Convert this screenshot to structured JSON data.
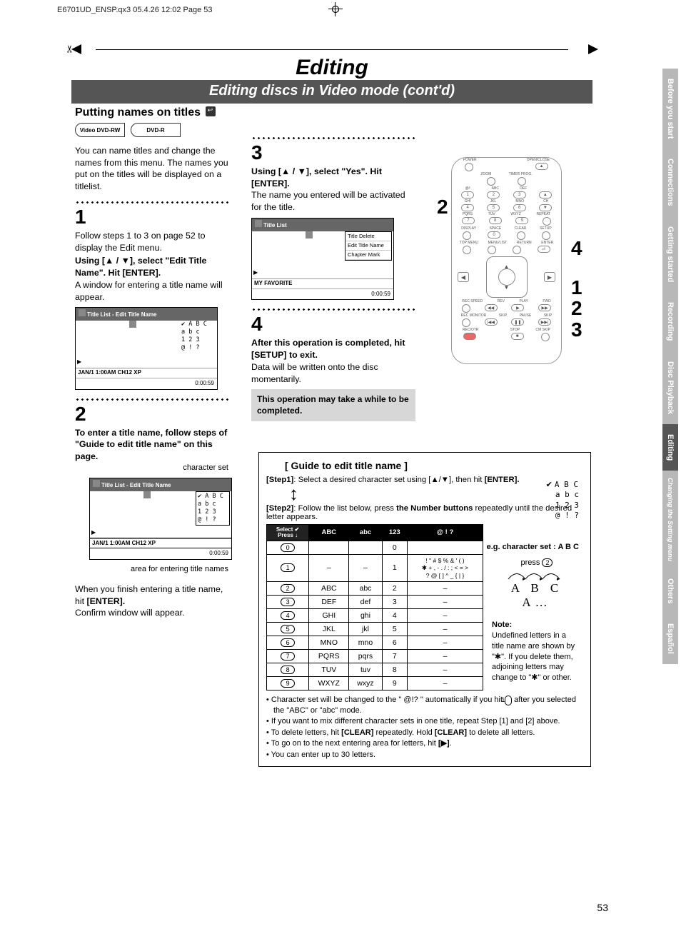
{
  "print_header": "E6701UD_ENSP.qx3  05.4.26 12:02  Page 53",
  "banner_title": "Editing",
  "banner_sub": "Editing discs in Video mode (cont'd)",
  "section_heading": "Putting names on titles",
  "disc_badges": [
    "Video DVD-RW",
    "DVD-R"
  ],
  "intro": "You can name titles and change the names from this menu. The names you put on the titles will be displayed on a titlelist.",
  "step1": {
    "num": "1",
    "p1": "Follow steps 1 to 3 on page 52 to display the Edit menu.",
    "b1": "Using [▲ / ▼], select \"Edit Title Name\". Hit [ENTER].",
    "p2": "A window for entering a title name will appear."
  },
  "tv1": {
    "header": "Title List - Edit Title Name",
    "charset": [
      "✔ A  B  C",
      "   a  b  c",
      "   1  2  3",
      "   @  !  ?"
    ],
    "status": "JAN/1 1:00AM CH12 XP",
    "foot": "0:00:59"
  },
  "step2": {
    "num": "2",
    "b1": "To enter a title name, follow steps of \"Guide to edit title name\" on this page.",
    "label_charset": "character set",
    "label_area": "area for entering title names",
    "p1": "When you finish entering a title name, hit ",
    "p1b": "[ENTER].",
    "p2": "Confirm window will appear."
  },
  "step3": {
    "num": "3",
    "b1": "Using [▲ / ▼], select \"Yes\". Hit [ENTER].",
    "p1": "The name you entered will be activated for the title."
  },
  "tv3": {
    "header": "Title List",
    "menu": [
      "Title Delete",
      "Edit Title Name",
      "Chapter Mark"
    ],
    "status": "MY FAVORITE",
    "foot": "0:00:59"
  },
  "step4": {
    "num": "4",
    "b1": "After this operation is completed, hit [SETUP] to exit.",
    "p1": "Data will be written onto the disc momentarily."
  },
  "note_box": "This operation may take a while to be completed.",
  "remote": {
    "top": [
      "POWER",
      "",
      "",
      "OPEN/CLOSE"
    ],
    "r1l": [
      "",
      "ZOOM",
      "TIMER PROG.",
      ""
    ],
    "keypad_labels": [
      [
        "@/:",
        "ABC",
        "DEF",
        ""
      ],
      [
        "GHI",
        "JKL",
        "MNO",
        "CH"
      ],
      [
        "PQRS",
        "TUV",
        "WXYZ",
        "REPEAT"
      ]
    ],
    "keypad": [
      [
        "1",
        "2",
        "3",
        "▲"
      ],
      [
        "4",
        "5",
        "6",
        "▼"
      ],
      [
        "7",
        "8",
        "9",
        ""
      ]
    ],
    "row4l": [
      "DISPLAY",
      "SPACE",
      "CLEAR",
      "SETUP"
    ],
    "row4": [
      "",
      "0",
      "",
      ""
    ],
    "row5l": [
      "TOP MENU",
      "MENU/LIST",
      "RETURN",
      "ENTER"
    ],
    "ctrl1l": [
      "REC SPEED",
      "REV",
      "PLAY",
      "FWD"
    ],
    "ctrl1": [
      "",
      "◀◀",
      "▶",
      "▶▶"
    ],
    "ctrl2l": [
      "REC MONITOR",
      "SKIP",
      "PAUSE",
      "SKIP"
    ],
    "ctrl2": [
      "",
      "|◀◀",
      "❚❚",
      "▶▶|"
    ],
    "ctrl3l": [
      "REC/OTR",
      "",
      "STOP",
      "CM SKIP"
    ],
    "ctrl3": [
      "",
      "",
      "■",
      ""
    ]
  },
  "callout_2": "2",
  "callout_4": "4",
  "callout_123": "1\n2\n3",
  "guide": {
    "title": "[ Guide to edit title name ]",
    "step1_l": "[Step1]",
    "step1_t": ": Select a desired character set using [▲/▼], then hit ",
    "step1_b": "[ENTER].",
    "mini_charset": [
      "A B C",
      "a b c",
      "1 2 3",
      "@ ! ?"
    ],
    "step2_l": "[Step2]",
    "step2_t": ": Follow the list below, press ",
    "step2_b": "the Number buttons",
    "step2_t2": " repeatedly until the desired letter appears.",
    "eg": "e.g. character set : A B C",
    "press": "press",
    "press_key": "2",
    "letters": "A  B  C  A…",
    "table_head_sel": "Select ✔\nPress",
    "table_head": [
      "ABC",
      "abc",
      "123",
      "@ ! ?"
    ],
    "rows": [
      {
        "k": "0",
        "c": [
          "<space>",
          "<space>",
          "0",
          "<space>"
        ]
      },
      {
        "k": "1",
        "c": [
          "–",
          "–",
          "1",
          "! \" # $ % & ' ( )\n✱ + , - . / : ; < = >\n? @ [ ] ^ _ { | }"
        ]
      },
      {
        "k": "2",
        "c": [
          "ABC",
          "abc",
          "2",
          "–"
        ]
      },
      {
        "k": "3",
        "c": [
          "DEF",
          "def",
          "3",
          "–"
        ]
      },
      {
        "k": "4",
        "c": [
          "GHI",
          "ghi",
          "4",
          "–"
        ]
      },
      {
        "k": "5",
        "c": [
          "JKL",
          "jkl",
          "5",
          "–"
        ]
      },
      {
        "k": "6",
        "c": [
          "MNO",
          "mno",
          "6",
          "–"
        ]
      },
      {
        "k": "7",
        "c": [
          "PQRS",
          "pqrs",
          "7",
          "–"
        ]
      },
      {
        "k": "8",
        "c": [
          "TUV",
          "tuv",
          "8",
          "–"
        ]
      },
      {
        "k": "9",
        "c": [
          "WXYZ",
          "wxyz",
          "9",
          "–"
        ]
      }
    ],
    "note_h": "Note:",
    "note": "Undefined letters in a title name are shown by \"✱\".  If you delete them, adjoining letters may change to \"✱\" or other.",
    "bullets": [
      "Character set will be changed to the \" @!? \" automatically if you hit <k>1</k> after you selected the \"ABC\" or \"abc\" mode.",
      "If you want to mix different character sets in one title, repeat Step [1] and [2] above.",
      "To delete letters, hit <b>[CLEAR]</b> repeatedly. Hold <b>[CLEAR]</b> to delete all letters.",
      "To go on to the next entering area for letters, hit <b>[▶]</b>.",
      "You can enter up to 30 letters."
    ]
  },
  "tabs": [
    "Before you start",
    "Connections",
    "Getting started",
    "Recording",
    "Disc Playback",
    "Editing",
    "Changing the Setting menu",
    "Others",
    "Español"
  ],
  "active_tab_index": 5,
  "pagenum": "53"
}
